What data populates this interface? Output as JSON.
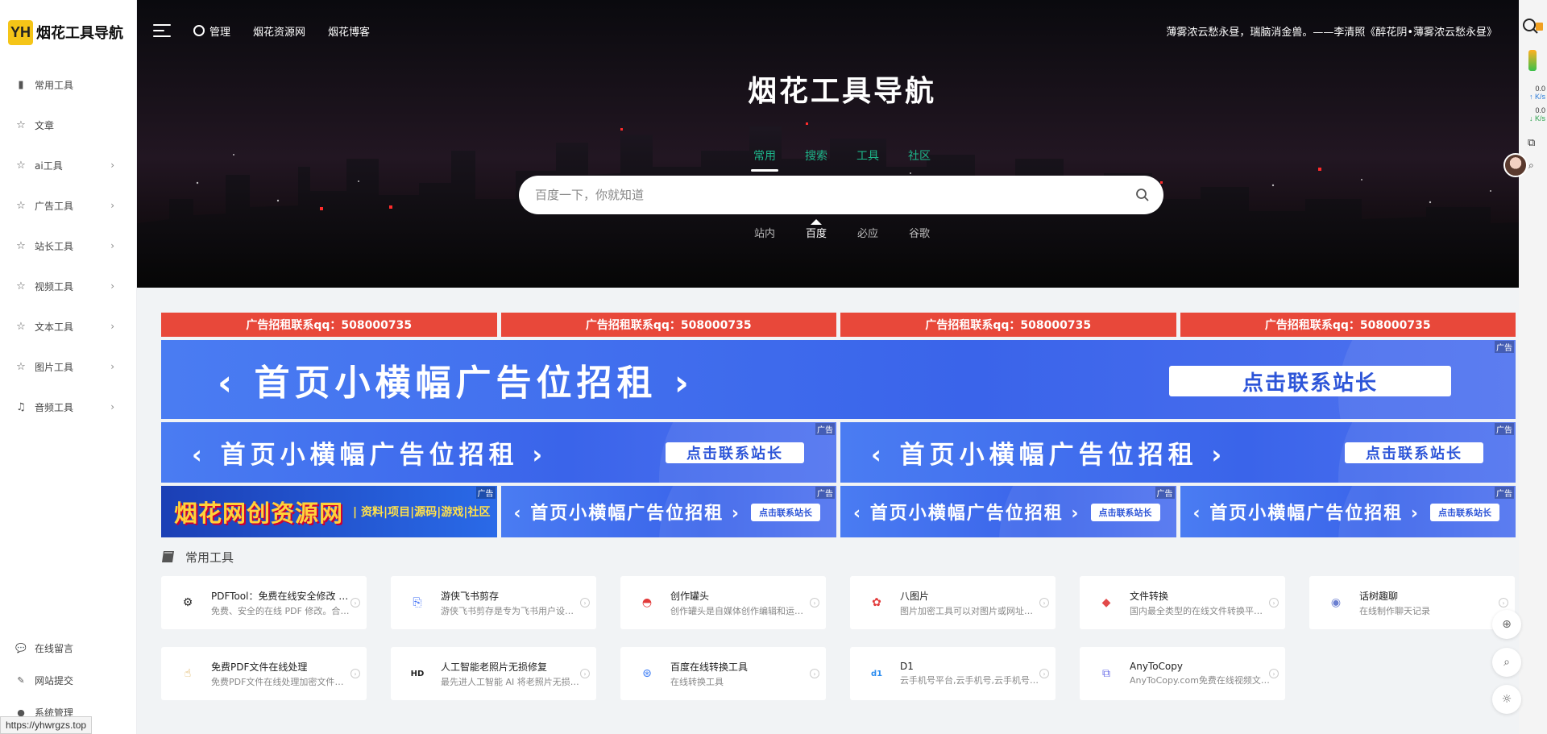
{
  "logo": {
    "badge": "YH",
    "text": "烟花工具导航"
  },
  "sidebar": {
    "items": [
      {
        "label": "常用工具",
        "icon": "book-icon",
        "glyph": "▮",
        "has_children": false
      },
      {
        "label": "文章",
        "icon": "star-icon",
        "glyph": "☆",
        "has_children": false
      },
      {
        "label": "ai工具",
        "icon": "star-icon",
        "glyph": "☆",
        "has_children": true
      },
      {
        "label": "广告工具",
        "icon": "star-icon",
        "glyph": "☆",
        "has_children": true
      },
      {
        "label": "站长工具",
        "icon": "star-icon",
        "glyph": "☆",
        "has_children": true
      },
      {
        "label": "视频工具",
        "icon": "star-icon",
        "glyph": "☆",
        "has_children": true
      },
      {
        "label": "文本工具",
        "icon": "star-icon",
        "glyph": "☆",
        "has_children": true
      },
      {
        "label": "图片工具",
        "icon": "star-icon",
        "glyph": "☆",
        "has_children": true
      },
      {
        "label": "音频工具",
        "icon": "music-icon",
        "glyph": "♫",
        "has_children": true
      }
    ],
    "bottom": [
      {
        "label": "在线留言",
        "icon": "chat-icon",
        "glyph": "💬"
      },
      {
        "label": "网站提交",
        "icon": "pencil-icon",
        "glyph": "✎"
      },
      {
        "label": "系统管理",
        "icon": "user-icon",
        "glyph": "●"
      }
    ],
    "chevron": "›"
  },
  "status_url": "https://yhwrgzs.top",
  "topbar": {
    "links": [
      {
        "label": "管理"
      },
      {
        "label": "烟花资源网"
      },
      {
        "label": "烟花博客"
      }
    ],
    "quote": "薄雾浓云愁永昼，瑞脑消金兽。——李清照《醉花阴•薄雾浓云愁永昼》"
  },
  "hero": {
    "title": "烟花工具导航",
    "tabs": [
      "常用",
      "搜索",
      "工具",
      "社区"
    ],
    "active_tab": 0,
    "search_placeholder": "百度一下，你就知道",
    "engines": [
      "站内",
      "百度",
      "必应",
      "谷歌"
    ],
    "active_engine": 1
  },
  "right_bar": {
    "up_value": "0.0",
    "up_unit": "↑ K/s",
    "down_value": "0.0",
    "down_unit": "↓ K/s"
  },
  "ads": {
    "red": [
      "广告招租联系qq：508000735",
      "广告招租联系qq：508000735",
      "广告招租联系qq：508000735",
      "广告招租联系qq：508000735"
    ],
    "tag": "广告",
    "banner_text": "‹ 首页小横幅广告位招租 ›",
    "banner_btn": "点击联系站长",
    "yh_left": "烟花网创资源网",
    "yh_right": "| 资料|项目|源码|游戏|社区"
  },
  "section": {
    "title": "常用工具"
  },
  "tools": [
    {
      "title": "PDFTool：免费在线安全修改 PDF",
      "desc": "免费、安全的在线 PDF 修改。合并、拆分",
      "icon": "gear-icon",
      "glyph": "⚙",
      "color": "#222222"
    },
    {
      "title": "游侠飞书剪存",
      "desc": "游侠飞书剪存是专为飞书用户设计的网页剪藏",
      "icon": "file-icon",
      "glyph": "⎘",
      "color": "#3b6cf5"
    },
    {
      "title": "创作罐头",
      "desc": "创作罐头是自媒体创作编辑和运营管理工具",
      "icon": "can-icon",
      "glyph": "◓",
      "color": "#e23b3b"
    },
    {
      "title": "八图片",
      "desc": "图片加密工具可以对图片或网址进行加密处理",
      "icon": "image-icon",
      "glyph": "✿",
      "color": "#e23b3b"
    },
    {
      "title": "文件转换",
      "desc": "国内最全类型的在线文件转换平台，支持",
      "icon": "cube-icon",
      "glyph": "◆",
      "color": "#e24a4a"
    },
    {
      "title": "话树趣聊",
      "desc": "在线制作聊天记录",
      "icon": "chat-bubble-icon",
      "glyph": "◉",
      "color": "#6b7fd1"
    },
    {
      "title": "免费PDF文件在线处理",
      "desc": "免费PDF文件在线处理加密文件也能处理",
      "icon": "hand-icon",
      "glyph": "☝",
      "color": "#d8a23a"
    },
    {
      "title": "人工智能老照片无损修复",
      "desc": "最先进人工智能 AI 将老照片无损高清修复",
      "icon": "hd-icon",
      "glyph": "HD",
      "color": "#222222"
    },
    {
      "title": "百度在线转换工具",
      "desc": "在线转换工具",
      "icon": "convert-icon",
      "glyph": "⊛",
      "color": "#3b7bf5"
    },
    {
      "title": "D1",
      "desc": "云手机号平台,云手机号,云手机号码,免费",
      "icon": "d1-icon",
      "glyph": "d1",
      "color": "#2b8cf0"
    },
    {
      "title": "AnyToCopy",
      "desc": "AnyToCopy.com免费在线视频文案提取工具",
      "icon": "copy-icon",
      "glyph": "⧉",
      "color": "#6b6fe8"
    }
  ],
  "float_buttons": [
    {
      "icon": "plus-icon",
      "glyph": "⊕"
    },
    {
      "icon": "search-icon",
      "glyph": "⌕"
    },
    {
      "icon": "sun-icon",
      "glyph": "☼"
    }
  ]
}
